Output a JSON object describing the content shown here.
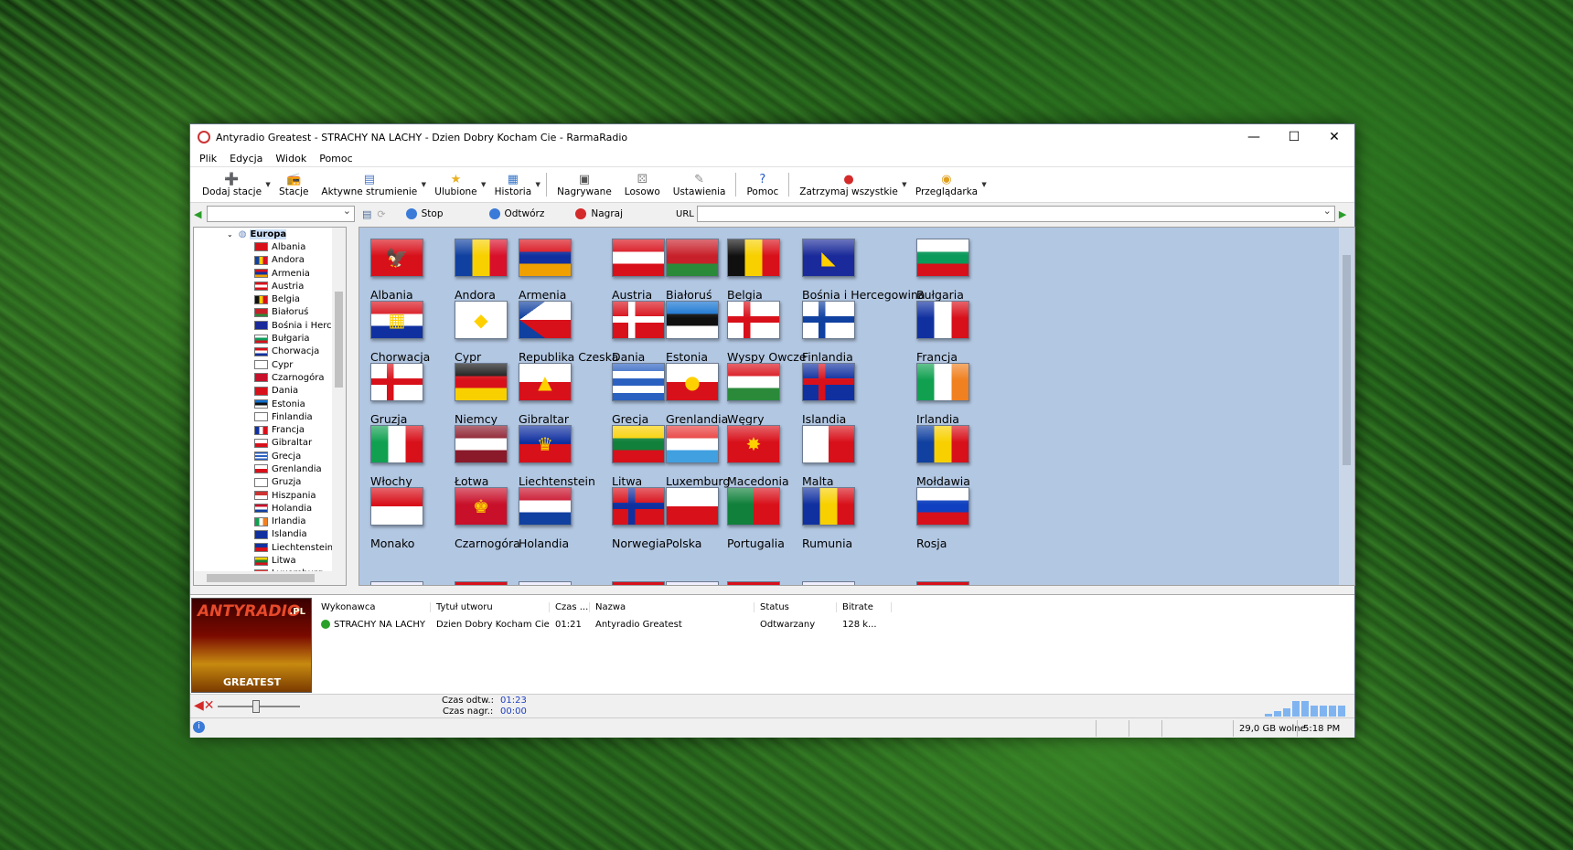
{
  "window": {
    "title": "Antyradio Greatest - STRACHY NA LACHY - Dzien Dobry Kocham Cie - RarmaRadio",
    "controls": {
      "minimize": "—",
      "maximize": "☐",
      "close": "✕"
    }
  },
  "menu": [
    "Plik",
    "Edycja",
    "Widok",
    "Pomoc"
  ],
  "toolbar": [
    {
      "label": "Dodaj stacje",
      "icon": "➕",
      "color": "#2a9d2a",
      "drop": true
    },
    {
      "label": "Stacje",
      "icon": "📻",
      "color": "#d9a020",
      "drop": false
    },
    {
      "label": "Aktywne strumienie",
      "icon": "▤",
      "color": "#4a7ac8",
      "drop": true
    },
    {
      "label": "Ulubione",
      "icon": "★",
      "color": "#e8b020",
      "drop": true
    },
    {
      "label": "Historia",
      "icon": "▦",
      "color": "#3a78c8",
      "drop": true
    },
    {
      "label": "Nagrywane",
      "icon": "▣",
      "color": "#555",
      "drop": false
    },
    {
      "label": "Losowo",
      "icon": "⚄",
      "color": "#888",
      "drop": false
    },
    {
      "label": "Ustawienia",
      "icon": "✎",
      "color": "#888",
      "drop": false
    },
    {
      "label": "Pomoc",
      "icon": "?",
      "color": "#2a5ac8",
      "drop": false
    },
    {
      "label": "Zatrzymaj wszystkie",
      "icon": "●",
      "color": "#d42a2a",
      "drop": true
    },
    {
      "label": "Przeglądarka",
      "icon": "◉",
      "color": "#e0a020",
      "drop": true
    }
  ],
  "address": {
    "stop_label": "Stop",
    "play_label": "Odtwórz",
    "record_label": "Nagraj",
    "url_label": "URL",
    "url_value": ""
  },
  "tree": {
    "root": "Europa",
    "items": [
      "Albania",
      "Andora",
      "Armenia",
      "Austria",
      "Belgia",
      "Białoruś",
      "Bośnia i Hercegowina",
      "Bułgaria",
      "Chorwacja",
      "Cypr",
      "Czarnogóra",
      "Dania",
      "Estonia",
      "Finlandia",
      "Francja",
      "Gibraltar",
      "Grecja",
      "Grenlandia",
      "Gruzja",
      "Hiszpania",
      "Holandia",
      "Irlandia",
      "Islandia",
      "Liechtenstein",
      "Litwa",
      "Luxemburg"
    ]
  },
  "flags": [
    {
      "name": "Albania",
      "c": [
        "#d8101a"
      ],
      "e": "🦅"
    },
    {
      "name": "Andora",
      "c": [
        "#1040a0",
        "#f8d000",
        "#d8102a"
      ],
      "v": true
    },
    {
      "name": "Armenia",
      "c": [
        "#d8101a",
        "#1030a0",
        "#f0a000"
      ]
    },
    {
      "name": "Austria",
      "c": [
        "#d8101a",
        "#ffffff",
        "#d8101a"
      ]
    },
    {
      "name": "Białoruś",
      "c": [
        "#c8202a",
        "#c8202a",
        "#2a8a3a"
      ]
    },
    {
      "name": "Belgia",
      "c": [
        "#101010",
        "#f8d000",
        "#d8101a"
      ],
      "v": true
    },
    {
      "name": "Bośnia i Hercegowina",
      "c": [
        "#1a2a9a"
      ],
      "e": "◣"
    },
    {
      "name": "Bułgaria",
      "c": [
        "#ffffff",
        "#0a9a5a",
        "#d8101a"
      ]
    },
    {
      "name": "Chorwacja",
      "c": [
        "#d8101a",
        "#ffffff",
        "#1030a0"
      ],
      "e": "▦"
    },
    {
      "name": "Cypr",
      "c": [
        "#ffffff"
      ],
      "e": "◆"
    },
    {
      "name": "Republika Czeska",
      "c": [
        "#ffffff",
        "#d8101a"
      ],
      "tri": "#1040a0"
    },
    {
      "name": "Dania",
      "c": [
        "#d8101a"
      ],
      "cross": "#ffffff"
    },
    {
      "name": "Estonia",
      "c": [
        "#1070d0",
        "#101010",
        "#ffffff"
      ]
    },
    {
      "name": "Wyspy Owcze",
      "c": [
        "#ffffff"
      ],
      "cross": "#d8101a"
    },
    {
      "name": "Finlandia",
      "c": [
        "#ffffff"
      ],
      "cross": "#1040a0"
    },
    {
      "name": "Francja",
      "c": [
        "#1030a0",
        "#ffffff",
        "#d8101a"
      ],
      "v": true
    },
    {
      "name": "Gruzja",
      "c": [
        "#ffffff"
      ],
      "cross": "#d8101a"
    },
    {
      "name": "Niemcy",
      "c": [
        "#101010",
        "#d8101a",
        "#f8d000"
      ]
    },
    {
      "name": "Gibraltar",
      "c": [
        "#ffffff",
        "#d8101a"
      ],
      "e": "▲"
    },
    {
      "name": "Grecja",
      "c": [
        "#2a60c0",
        "#ffffff",
        "#2a60c0",
        "#ffffff",
        "#2a60c0"
      ]
    },
    {
      "name": "Grenlandia",
      "c": [
        "#ffffff",
        "#d8101a"
      ],
      "e": "●"
    },
    {
      "name": "Węgry",
      "c": [
        "#d8101a",
        "#ffffff",
        "#2a8a3a"
      ]
    },
    {
      "name": "Islandia",
      "c": [
        "#1030a0"
      ],
      "cross": "#d8101a"
    },
    {
      "name": "Irlandia",
      "c": [
        "#10a050",
        "#ffffff",
        "#f08020"
      ],
      "v": true
    },
    {
      "name": "Włochy",
      "c": [
        "#10a050",
        "#ffffff",
        "#d8101a"
      ],
      "v": true
    },
    {
      "name": "Łotwa",
      "c": [
        "#8a1a2a",
        "#ffffff",
        "#8a1a2a"
      ]
    },
    {
      "name": "Liechtenstein",
      "c": [
        "#1030a0",
        "#d8101a"
      ],
      "e": "♛"
    },
    {
      "name": "Litwa",
      "c": [
        "#f8d000",
        "#10803a",
        "#d8101a"
      ]
    },
    {
      "name": "Luxemburg",
      "c": [
        "#e83a3a",
        "#ffffff",
        "#40a0e0"
      ]
    },
    {
      "name": "Macedonia",
      "c": [
        "#d8101a"
      ],
      "e": "✸"
    },
    {
      "name": "Malta",
      "c": [
        "#ffffff",
        "#d8101a"
      ],
      "v": true
    },
    {
      "name": "Mołdawia",
      "c": [
        "#1040a0",
        "#f8d000",
        "#d8101a"
      ],
      "v": true
    },
    {
      "name": "Monako",
      "c": [
        "#d8101a",
        "#ffffff"
      ]
    },
    {
      "name": "Czarnogóra",
      "c": [
        "#c8102a"
      ],
      "e": "♚"
    },
    {
      "name": "Holandia",
      "c": [
        "#c8102a",
        "#ffffff",
        "#1040a0"
      ]
    },
    {
      "name": "Norwegia",
      "c": [
        "#d8101a"
      ],
      "cross": "#1030a0"
    },
    {
      "name": "Polska",
      "c": [
        "#ffffff",
        "#d8101a"
      ]
    },
    {
      "name": "Portugalia",
      "c": [
        "#10803a",
        "#d8101a"
      ],
      "v": true
    },
    {
      "name": "Rumunia",
      "c": [
        "#1030a0",
        "#f8d000",
        "#d8101a"
      ],
      "v": true
    },
    {
      "name": "Rosja",
      "c": [
        "#ffffff",
        "#1040c0",
        "#d8101a"
      ]
    }
  ],
  "logo": {
    "brand": "ANTYRADIO",
    "suffix": ".PL",
    "tag": "GREATEST"
  },
  "nowplaying": {
    "headers": [
      "Wykonawca",
      "Tytuł utworu",
      "Czas ...",
      "Nazwa",
      "Status",
      "Bitrate"
    ],
    "rows": [
      [
        "STRACHY NA LACHY",
        "Dzien Dobry Kocham Cie",
        "01:21",
        "Antyradio Greatest",
        "Odtwarzany",
        "128 k..."
      ]
    ]
  },
  "status": {
    "play_time_label": "Czas odtw.:",
    "play_time": "01:23",
    "rec_time_label": "Czas nagr.:",
    "rec_time": "00:00",
    "free_space": "29,0 GB wolne",
    "clock": "5:18 PM",
    "volume": 0.45
  },
  "visualizer": [
    0.15,
    0.3,
    0.45,
    0.85,
    0.85,
    0.6,
    0.6,
    0.6,
    0.6
  ]
}
